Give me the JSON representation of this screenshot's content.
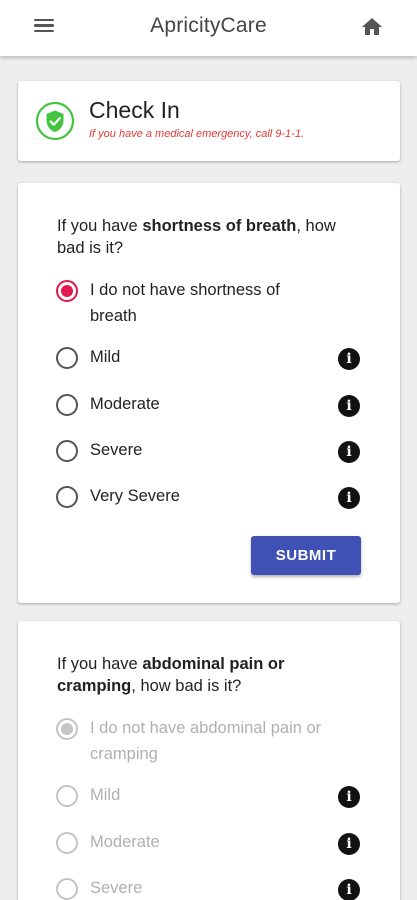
{
  "app": {
    "title": "ApricityCare"
  },
  "checkin": {
    "heading": "Check In",
    "warning": "If you have a medical emergency, call 9-1-1."
  },
  "q1": {
    "prefix": "If you have ",
    "bold": "shortness of breath",
    "suffix": ", how bad is it?",
    "options": [
      {
        "label": "I do not have shortness of breath",
        "selected": true
      },
      {
        "label": "Mild",
        "selected": false
      },
      {
        "label": "Moderate",
        "selected": false
      },
      {
        "label": "Severe",
        "selected": false
      },
      {
        "label": "Very Severe",
        "selected": false
      }
    ],
    "submit_label": "SUBMIT"
  },
  "q2": {
    "prefix": "If you have ",
    "bold": "abdominal pain or cramping",
    "suffix": ", how bad is it?",
    "options": [
      {
        "label": "I do not have abdominal pain or cramping",
        "selected": true
      },
      {
        "label": "Mild",
        "selected": false
      },
      {
        "label": "Moderate",
        "selected": false
      },
      {
        "label": "Severe",
        "selected": false
      }
    ]
  },
  "colors": {
    "accent": "#3f51b5",
    "selected_radio": "#e0194f",
    "warning": "#e53935",
    "check_green": "#43c43f"
  },
  "icons": {
    "menu": "menu-icon",
    "home": "home-icon",
    "shield": "shield-check-icon",
    "info": "info-icon"
  }
}
